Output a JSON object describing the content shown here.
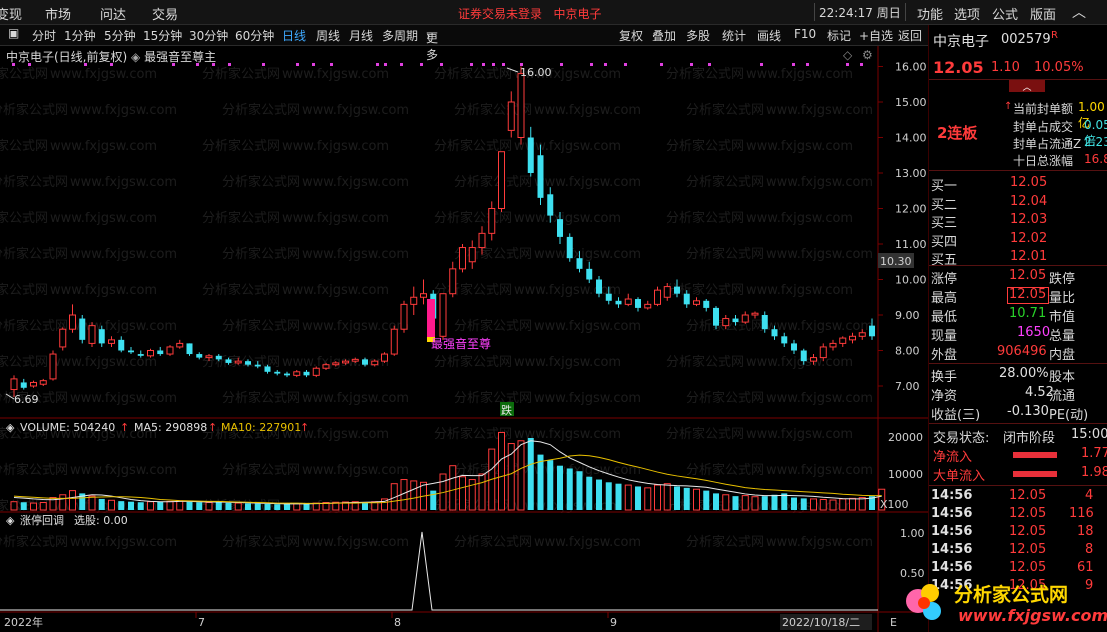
{
  "topbar": {
    "menus": [
      "变现",
      "市场",
      "问达",
      "交易"
    ],
    "notice": "证券交易未登录",
    "stock_name": "中京电子",
    "clock": "22:24:17 周日",
    "right_menus": [
      "功能",
      "选项",
      "公式",
      "版面"
    ]
  },
  "periods": {
    "items": [
      "分时",
      "1分钟",
      "5分钟",
      "15分钟",
      "30分钟",
      "60分钟",
      "日线",
      "周线",
      "月线",
      "多周期",
      "更多"
    ],
    "active": "日线",
    "tools": [
      "复权",
      "叠加",
      "多股",
      "统计",
      "画线",
      "F10",
      "标记",
      "+自选",
      "返回"
    ]
  },
  "chart_head": {
    "title": "中京电子(日线,前复权)",
    "formula": "最强音至尊主"
  },
  "price_axis": [
    "16.00",
    "15.00",
    "14.00",
    "13.00",
    "12.00",
    "11.00",
    "10.00",
    "9.00",
    "8.00",
    "7.00"
  ],
  "current_tag": "10.30",
  "annotations": {
    "high": "16.00",
    "low": "6.69",
    "signal": "最强音至尊",
    "drop_marker": "跌"
  },
  "volume": {
    "label": "VOLUME: 504240",
    "ma5": "MA5: 290898",
    "ma10": "MA10: 227901",
    "axis": [
      "20000",
      "10000"
    ],
    "unit": "X100"
  },
  "indicator": {
    "label": "涨停回调",
    "value": "选股: 0.00",
    "axis": [
      "1.00",
      "0.50"
    ]
  },
  "time_axis": [
    "2022年",
    "7",
    "8",
    "9",
    "2022/10/18/二"
  ],
  "time_axis_end": "E",
  "quote": {
    "name": "中京电子",
    "code": "002579",
    "code_suffix": "R",
    "price": "12.05",
    "change": "1.10",
    "pct": "10.05%",
    "limit_up_tag": "2连板",
    "seal_rows": [
      {
        "label": "当前封单额",
        "value": "1.00亿"
      },
      {
        "label": "封单占成交",
        "value": "0.05倍"
      },
      {
        "label": "封单占流通Z",
        "value": "2.23%"
      },
      {
        "label": "十日总涨幅",
        "value": "16.88%"
      }
    ],
    "bids": [
      {
        "label": "买一",
        "price": "12.05"
      },
      {
        "label": "买二",
        "price": "12.04"
      },
      {
        "label": "买三",
        "price": "12.03"
      },
      {
        "label": "买四",
        "price": "12.02"
      },
      {
        "label": "买五",
        "price": "12.01"
      }
    ],
    "stats_left": [
      {
        "label": "涨停",
        "value": "12.05",
        "color": "red"
      },
      {
        "label": "最高",
        "value": "12.05",
        "color": "red"
      },
      {
        "label": "最低",
        "value": "10.71",
        "color": "grn"
      },
      {
        "label": "现量",
        "value": "1650",
        "color": "mag"
      },
      {
        "label": "外盘",
        "value": "906496",
        "color": "red"
      }
    ],
    "stats_right": [
      "跌停",
      "量比",
      "市值",
      "总量",
      "内盘"
    ],
    "fund_rows": [
      {
        "label": "换手",
        "value": "28.00%",
        "tail": "股本"
      },
      {
        "label": "净资",
        "value": "4.52",
        "tail": "流通"
      },
      {
        "label": "收益(三)",
        "value": "-0.130",
        "tail": "PE(动)"
      }
    ],
    "trade_state_label": "交易状态:",
    "trade_state": "闭市阶段",
    "trade_state_time": "15:00",
    "flows": [
      {
        "label": "净流入",
        "value": "1.77"
      },
      {
        "label": "大单流入",
        "value": "1.98"
      }
    ],
    "ticks": [
      {
        "time": "14:56",
        "price": "12.05",
        "vol": "4"
      },
      {
        "time": "14:56",
        "price": "12.05",
        "vol": "116"
      },
      {
        "time": "14:56",
        "price": "12.05",
        "vol": "18"
      },
      {
        "time": "14:56",
        "price": "12.05",
        "vol": "8"
      },
      {
        "time": "14:56",
        "price": "12.05",
        "vol": "61"
      },
      {
        "time": "14:56",
        "price": "12.05",
        "vol": "9"
      }
    ]
  },
  "watermark": {
    "cn": "分析家公式网",
    "url": "www.fxjgsw.com"
  },
  "candles": [
    {
      "o": 6.9,
      "c": 7.2,
      "h": 7.3,
      "l": 6.69
    },
    {
      "o": 7.1,
      "c": 6.95,
      "h": 7.2,
      "l": 6.9
    },
    {
      "o": 7.0,
      "c": 7.1,
      "h": 7.15,
      "l": 6.95
    },
    {
      "o": 7.05,
      "c": 7.15,
      "h": 7.2,
      "l": 7.0
    },
    {
      "o": 7.2,
      "c": 7.9,
      "h": 8.0,
      "l": 7.15
    },
    {
      "o": 8.1,
      "c": 8.6,
      "h": 8.65,
      "l": 8.0
    },
    {
      "o": 8.6,
      "c": 9.0,
      "h": 9.3,
      "l": 8.5
    },
    {
      "o": 8.9,
      "c": 8.3,
      "h": 9.0,
      "l": 8.2
    },
    {
      "o": 8.2,
      "c": 8.7,
      "h": 8.8,
      "l": 8.1
    },
    {
      "o": 8.6,
      "c": 8.2,
      "h": 8.7,
      "l": 8.1
    },
    {
      "o": 8.2,
      "c": 8.3,
      "h": 8.4,
      "l": 8.1
    },
    {
      "o": 8.3,
      "c": 8.0,
      "h": 8.4,
      "l": 7.95
    },
    {
      "o": 8.0,
      "c": 7.95,
      "h": 8.1,
      "l": 7.9
    },
    {
      "o": 7.9,
      "c": 7.85,
      "h": 8.0,
      "l": 7.8
    },
    {
      "o": 7.85,
      "c": 8.0,
      "h": 8.05,
      "l": 7.8
    },
    {
      "o": 8.0,
      "c": 7.9,
      "h": 8.1,
      "l": 7.85
    },
    {
      "o": 7.9,
      "c": 8.1,
      "h": 8.15,
      "l": 7.85
    },
    {
      "o": 8.1,
      "c": 8.2,
      "h": 8.3,
      "l": 8.05
    },
    {
      "o": 8.2,
      "c": 7.9,
      "h": 8.2,
      "l": 7.85
    },
    {
      "o": 7.9,
      "c": 7.8,
      "h": 7.95,
      "l": 7.75
    },
    {
      "o": 7.8,
      "c": 7.85,
      "h": 7.9,
      "l": 7.7
    },
    {
      "o": 7.85,
      "c": 7.75,
      "h": 7.9,
      "l": 7.7
    },
    {
      "o": 7.75,
      "c": 7.65,
      "h": 7.8,
      "l": 7.6
    },
    {
      "o": 7.65,
      "c": 7.7,
      "h": 7.8,
      "l": 7.6
    },
    {
      "o": 7.7,
      "c": 7.6,
      "h": 7.75,
      "l": 7.55
    },
    {
      "o": 7.6,
      "c": 7.55,
      "h": 7.7,
      "l": 7.5
    },
    {
      "o": 7.55,
      "c": 7.4,
      "h": 7.6,
      "l": 7.35
    },
    {
      "o": 7.4,
      "c": 7.35,
      "h": 7.45,
      "l": 7.3
    },
    {
      "o": 7.35,
      "c": 7.3,
      "h": 7.4,
      "l": 7.25
    },
    {
      "o": 7.3,
      "c": 7.4,
      "h": 7.45,
      "l": 7.25
    },
    {
      "o": 7.4,
      "c": 7.3,
      "h": 7.45,
      "l": 7.25
    },
    {
      "o": 7.3,
      "c": 7.5,
      "h": 7.55,
      "l": 7.25
    },
    {
      "o": 7.5,
      "c": 7.6,
      "h": 7.65,
      "l": 7.45
    },
    {
      "o": 7.6,
      "c": 7.65,
      "h": 7.7,
      "l": 7.55
    },
    {
      "o": 7.65,
      "c": 7.7,
      "h": 7.75,
      "l": 7.6
    },
    {
      "o": 7.7,
      "c": 7.75,
      "h": 7.8,
      "l": 7.65
    },
    {
      "o": 7.75,
      "c": 7.6,
      "h": 7.8,
      "l": 7.55
    },
    {
      "o": 7.6,
      "c": 7.7,
      "h": 7.75,
      "l": 7.55
    },
    {
      "o": 7.7,
      "c": 7.9,
      "h": 7.95,
      "l": 7.65
    },
    {
      "o": 7.9,
      "c": 8.6,
      "h": 8.7,
      "l": 7.85
    },
    {
      "o": 8.6,
      "c": 9.3,
      "h": 9.4,
      "l": 8.5
    },
    {
      "o": 9.3,
      "c": 9.5,
      "h": 9.8,
      "l": 9.0
    },
    {
      "o": 9.5,
      "c": 9.6,
      "h": 10.0,
      "l": 9.3
    },
    {
      "o": 9.6,
      "c": 8.9,
      "h": 9.7,
      "l": 8.8
    },
    {
      "o": 8.4,
      "c": 9.6,
      "h": 9.6,
      "l": 8.3
    },
    {
      "o": 9.6,
      "c": 10.3,
      "h": 10.5,
      "l": 9.5
    },
    {
      "o": 10.3,
      "c": 10.9,
      "h": 11.0,
      "l": 10.2
    },
    {
      "o": 10.5,
      "c": 10.9,
      "h": 11.1,
      "l": 10.3
    },
    {
      "o": 10.9,
      "c": 11.3,
      "h": 11.5,
      "l": 10.7
    },
    {
      "o": 11.3,
      "c": 12.0,
      "h": 12.2,
      "l": 11.1
    },
    {
      "o": 12.0,
      "c": 13.6,
      "h": 13.6,
      "l": 11.9
    },
    {
      "o": 14.2,
      "c": 15.0,
      "h": 15.3,
      "l": 14.0
    },
    {
      "o": 14.0,
      "c": 15.8,
      "h": 16.0,
      "l": 13.8
    },
    {
      "o": 14.0,
      "c": 13.0,
      "h": 14.3,
      "l": 12.9
    },
    {
      "o": 13.5,
      "c": 12.3,
      "h": 13.8,
      "l": 12.1
    },
    {
      "o": 12.4,
      "c": 11.8,
      "h": 12.6,
      "l": 11.6
    },
    {
      "o": 11.7,
      "c": 11.2,
      "h": 11.9,
      "l": 11.0
    },
    {
      "o": 11.2,
      "c": 10.6,
      "h": 11.3,
      "l": 10.5
    },
    {
      "o": 10.6,
      "c": 10.3,
      "h": 10.8,
      "l": 10.2
    },
    {
      "o": 10.3,
      "c": 10.0,
      "h": 10.5,
      "l": 9.9
    },
    {
      "o": 10.0,
      "c": 9.6,
      "h": 10.1,
      "l": 9.5
    },
    {
      "o": 9.6,
      "c": 9.4,
      "h": 9.8,
      "l": 9.3
    },
    {
      "o": 9.4,
      "c": 9.3,
      "h": 9.5,
      "l": 9.2
    },
    {
      "o": 9.3,
      "c": 9.45,
      "h": 9.6,
      "l": 9.25
    },
    {
      "o": 9.45,
      "c": 9.2,
      "h": 9.5,
      "l": 9.1
    },
    {
      "o": 9.2,
      "c": 9.3,
      "h": 9.4,
      "l": 9.15
    },
    {
      "o": 9.3,
      "c": 9.7,
      "h": 9.8,
      "l": 9.25
    },
    {
      "o": 9.5,
      "c": 9.8,
      "h": 9.9,
      "l": 9.4
    },
    {
      "o": 9.8,
      "c": 9.6,
      "h": 10.0,
      "l": 9.5
    },
    {
      "o": 9.6,
      "c": 9.3,
      "h": 9.7,
      "l": 9.2
    },
    {
      "o": 9.3,
      "c": 9.4,
      "h": 9.5,
      "l": 9.25
    },
    {
      "o": 9.4,
      "c": 9.2,
      "h": 9.45,
      "l": 9.1
    },
    {
      "o": 9.2,
      "c": 8.7,
      "h": 9.25,
      "l": 8.6
    },
    {
      "o": 8.7,
      "c": 8.9,
      "h": 9.0,
      "l": 8.6
    },
    {
      "o": 8.9,
      "c": 8.8,
      "h": 9.0,
      "l": 8.7
    },
    {
      "o": 8.8,
      "c": 9.0,
      "h": 9.1,
      "l": 8.75
    },
    {
      "o": 9.0,
      "c": 9.05,
      "h": 9.1,
      "l": 8.9
    },
    {
      "o": 9.0,
      "c": 8.6,
      "h": 9.1,
      "l": 8.5
    },
    {
      "o": 8.6,
      "c": 8.4,
      "h": 8.7,
      "l": 8.3
    },
    {
      "o": 8.4,
      "c": 8.2,
      "h": 8.5,
      "l": 8.1
    },
    {
      "o": 8.2,
      "c": 8.0,
      "h": 8.3,
      "l": 7.9
    },
    {
      "o": 8.0,
      "c": 7.7,
      "h": 8.05,
      "l": 7.6
    },
    {
      "o": 7.7,
      "c": 7.8,
      "h": 7.9,
      "l": 7.6
    },
    {
      "o": 7.8,
      "c": 8.1,
      "h": 8.2,
      "l": 7.7
    },
    {
      "o": 8.1,
      "c": 8.2,
      "h": 8.3,
      "l": 8.0
    },
    {
      "o": 8.2,
      "c": 8.35,
      "h": 8.4,
      "l": 8.1
    },
    {
      "o": 8.3,
      "c": 8.4,
      "h": 8.5,
      "l": 8.2
    },
    {
      "o": 8.4,
      "c": 8.5,
      "h": 8.6,
      "l": 8.3
    },
    {
      "o": 8.7,
      "c": 8.4,
      "h": 8.9,
      "l": 8.3
    }
  ],
  "volumes": [
    30,
    28,
    25,
    27,
    45,
    55,
    70,
    60,
    50,
    40,
    35,
    32,
    30,
    28,
    30,
    29,
    31,
    33,
    30,
    28,
    27,
    29,
    26,
    25,
    24,
    23,
    22,
    21,
    22,
    23,
    22,
    25,
    27,
    28,
    29,
    30,
    28,
    30,
    40,
    95,
    110,
    105,
    100,
    70,
    130,
    160,
    120,
    110,
    130,
    220,
    280,
    240,
    250,
    260,
    200,
    180,
    160,
    150,
    140,
    120,
    110,
    100,
    95,
    90,
    85,
    80,
    90,
    95,
    85,
    80,
    75,
    70,
    60,
    55,
    50,
    52,
    48,
    50,
    55,
    60,
    45,
    42,
    40,
    38,
    36,
    40,
    42,
    45,
    50,
    75
  ],
  "ma5": [
    45,
    43,
    40,
    38,
    37,
    40,
    45,
    50,
    55,
    54,
    50,
    44,
    38,
    34,
    31,
    30,
    30,
    31,
    31,
    30,
    29,
    29,
    28,
    27,
    26,
    25,
    24,
    23,
    22,
    22,
    22,
    23,
    24,
    25,
    26,
    27,
    28,
    29,
    31,
    45,
    60,
    75,
    90,
    96,
    103,
    115,
    125,
    124,
    124,
    148,
    184,
    202,
    236,
    250,
    246,
    236,
    210,
    188,
    172,
    156,
    142,
    130,
    119,
    109,
    102,
    96,
    92,
    90,
    88,
    87,
    85,
    82,
    76,
    70,
    64,
    58,
    54,
    52,
    52,
    53,
    52,
    51,
    49,
    46,
    44,
    41,
    40,
    40,
    43,
    50
  ],
  "ma10": [
    50,
    48,
    46,
    44,
    42,
    42,
    42,
    44,
    46,
    47,
    48,
    48,
    47,
    45,
    42,
    38,
    36,
    34,
    33,
    32,
    31,
    31,
    30,
    29,
    28,
    27,
    26,
    25,
    25,
    25,
    24,
    24,
    24,
    25,
    25,
    25,
    26,
    26,
    27,
    32,
    37,
    43,
    50,
    56,
    63,
    72,
    81,
    90,
    99,
    111,
    121,
    131,
    150,
    165,
    175,
    181,
    187,
    195,
    198,
    196,
    190,
    182,
    172,
    163,
    155,
    146,
    137,
    129,
    123,
    118,
    113,
    107,
    100,
    93,
    87,
    81,
    77,
    74,
    72,
    70,
    68,
    66,
    64,
    62,
    60,
    57,
    55,
    53,
    52,
    52
  ]
}
